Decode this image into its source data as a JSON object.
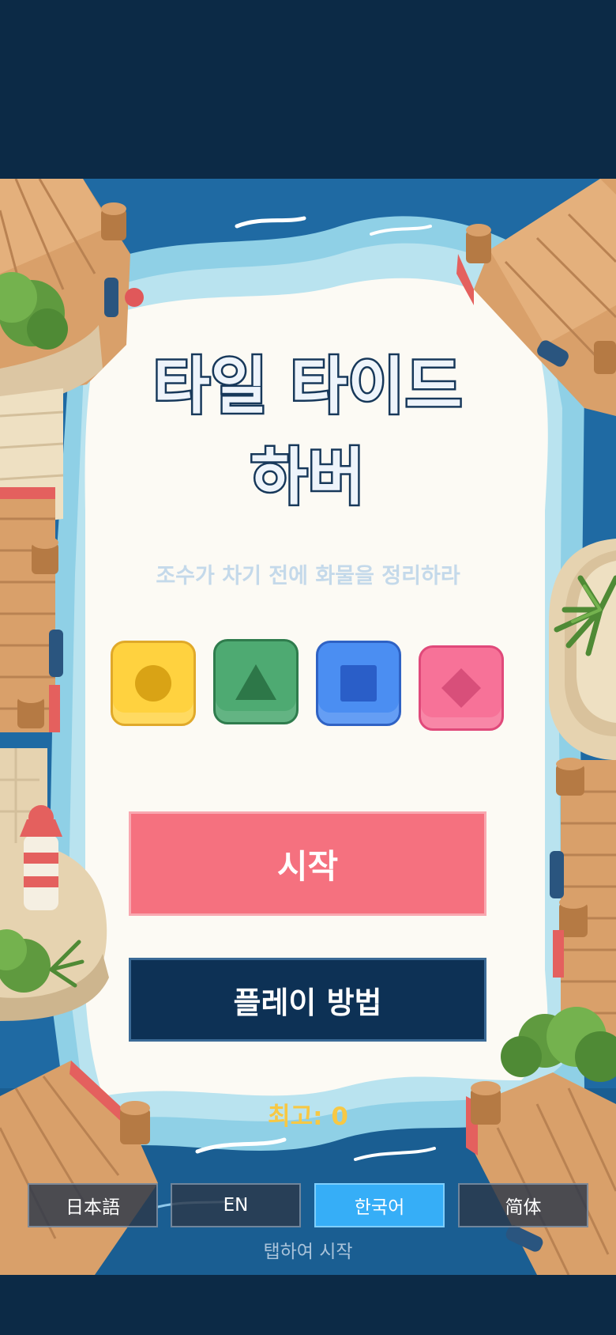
{
  "game": {
    "title_line1": "타일 타이드",
    "title_line2": "하버",
    "subtitle": "조수가 차기 전에 화물을 정리하라",
    "tiles": [
      {
        "name": "yellow-circle-tile",
        "color": "#ffd23f",
        "shape": "circle"
      },
      {
        "name": "green-triangle-tile",
        "color": "#4eaa72",
        "shape": "triangle"
      },
      {
        "name": "blue-square-tile",
        "color": "#4b8ef2",
        "shape": "square"
      },
      {
        "name": "pink-diamond-tile",
        "color": "#f77298",
        "shape": "diamond"
      }
    ],
    "start_label": "시작",
    "how_to_play_label": "플레이 방법",
    "best_score_label": "최고: 0",
    "languages": [
      "日本語",
      "EN",
      "한국어",
      "简体"
    ],
    "active_language": "한국어",
    "tap_hint": "탭하여 시작"
  },
  "colors": {
    "background": "#0c2a46",
    "water": "#1f6aa3",
    "panel": "#fcfaf4",
    "title_outline": "#17385a",
    "start_button": "#f5717f",
    "how_to_button": "#0d3155",
    "best_score": "#f7c844",
    "active_language": "#36aef7"
  }
}
